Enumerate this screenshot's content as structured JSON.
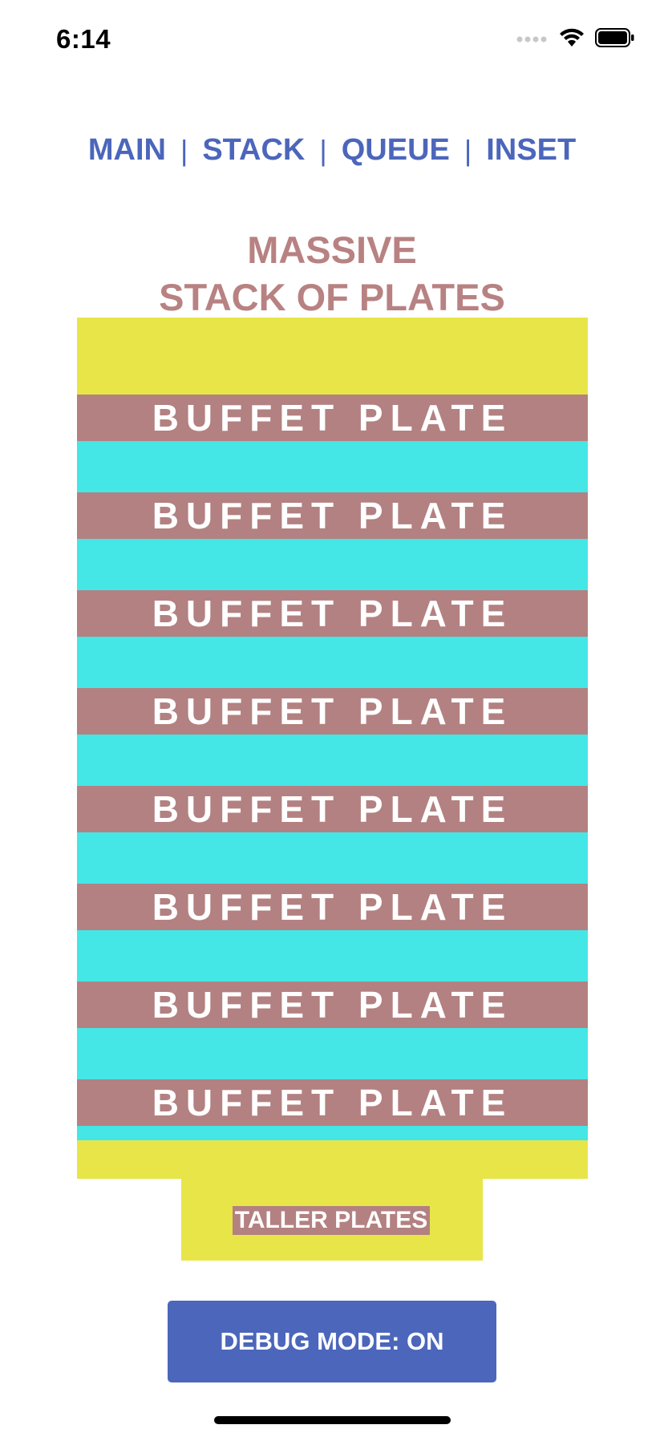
{
  "status_bar": {
    "time": "6:14",
    "icons": [
      "signal-icon",
      "wifi-icon",
      "battery-icon"
    ]
  },
  "nav": {
    "items": [
      "MAIN",
      "STACK",
      "QUEUE",
      "INSET"
    ],
    "separator": "|"
  },
  "title": {
    "line1": "MASSIVE",
    "line2": "STACK OF PLATES"
  },
  "plates": {
    "label": "BUFFET PLATE",
    "count": 8
  },
  "taller_button": "TALLER PLATES",
  "debug_button": "DEBUG MODE: ON",
  "colors": {
    "nav_blue": "#4b66bb",
    "title_mauve": "#b88282",
    "plate_mauve": "#b38181",
    "band_cyan": "#44e6e6",
    "stack_yellow": "#e7e548"
  }
}
